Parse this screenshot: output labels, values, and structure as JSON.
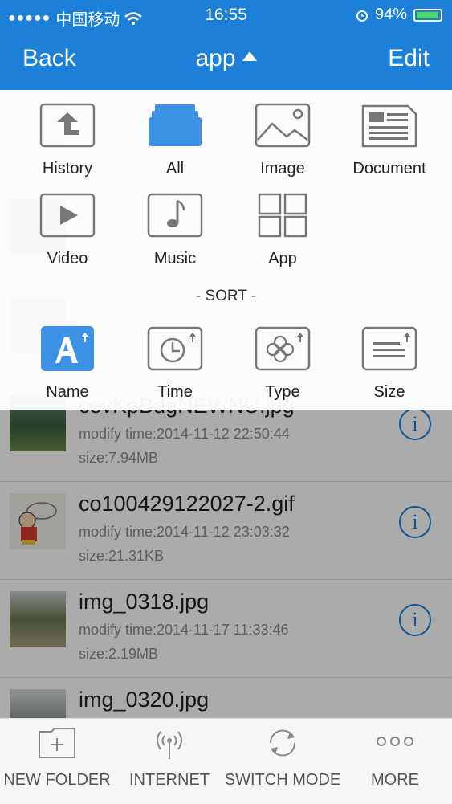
{
  "status": {
    "carrier": "中国移动",
    "time": "16:55",
    "battery": "94%"
  },
  "nav": {
    "back": "Back",
    "title": "app",
    "edit": "Edit"
  },
  "menu": {
    "categories": [
      {
        "label": "History",
        "icon": "upload-history-icon"
      },
      {
        "label": "All",
        "icon": "all-files-icon"
      },
      {
        "label": "Image",
        "icon": "image-icon"
      },
      {
        "label": "Document",
        "icon": "document-icon"
      },
      {
        "label": "Video",
        "icon": "video-icon"
      },
      {
        "label": "Music",
        "icon": "music-icon"
      },
      {
        "label": "App",
        "icon": "app-grid-icon"
      }
    ],
    "sort_title": "- SORT -",
    "sort": [
      {
        "label": "Name",
        "icon": "sort-name-icon"
      },
      {
        "label": "Time",
        "icon": "sort-time-icon"
      },
      {
        "label": "Type",
        "icon": "sort-type-icon"
      },
      {
        "label": "Size",
        "icon": "sort-size-icon"
      }
    ]
  },
  "files": [
    {
      "name": "cevKpBdgNEWNU.jpg",
      "mtime": "modify time:2014-11-12 22:50:44",
      "size": "size:7.94MB"
    },
    {
      "name": "co100429122027-2.gif",
      "mtime": "modify time:2014-11-12 23:03:32",
      "size": "size:21.31KB"
    },
    {
      "name": "img_0318.jpg",
      "mtime": "modify time:2014-11-17 11:33:46",
      "size": "size:2.19MB"
    },
    {
      "name": "img_0320.jpg",
      "mtime": "",
      "size": ""
    }
  ],
  "toolbar": {
    "new_folder": "NEW FOLDER",
    "internet": "INTERNET",
    "switch_mode": "SWITCH MODE",
    "more": "MORE"
  },
  "colors": {
    "accent": "#1c7fd8",
    "selected": "#3e92e6"
  }
}
